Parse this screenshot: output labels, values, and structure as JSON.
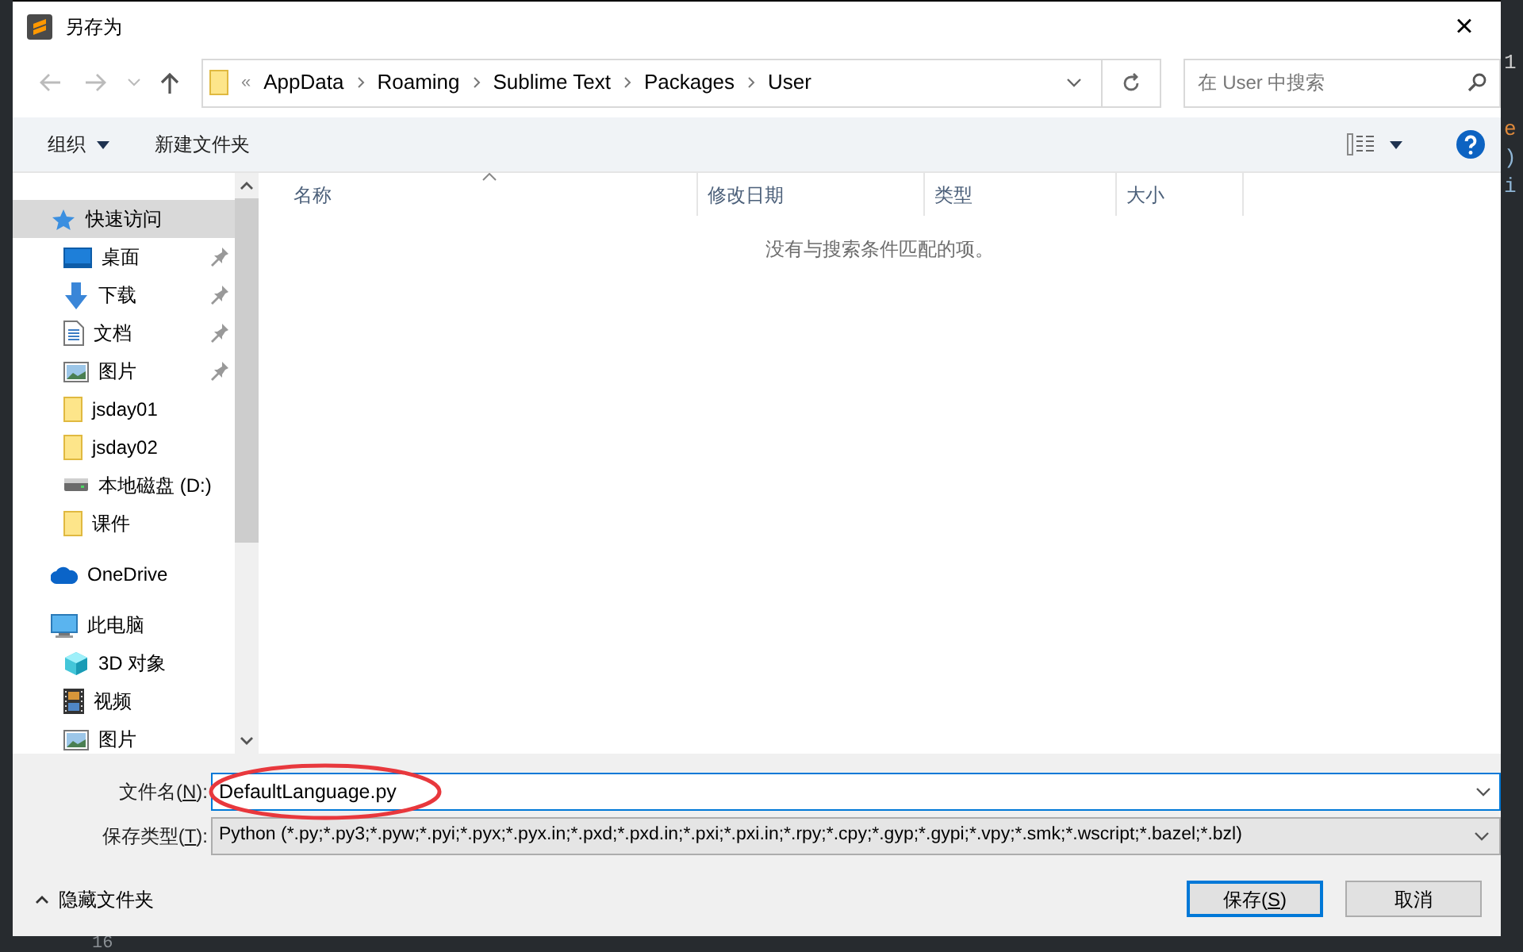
{
  "window": {
    "title": "另存为",
    "close": "×"
  },
  "address_bar": {
    "overflow": "«",
    "crumbs": [
      "AppData",
      "Roaming",
      "Sublime Text",
      "Packages",
      "User"
    ]
  },
  "search": {
    "placeholder": "在 User 中搜索"
  },
  "toolbar": {
    "organize": "组织",
    "new_folder": "新建文件夹"
  },
  "columns": [
    {
      "label": "名称",
      "sorted": true
    },
    {
      "label": "修改日期",
      "sorted": false
    },
    {
      "label": "类型",
      "sorted": false
    },
    {
      "label": "大小",
      "sorted": false
    }
  ],
  "empty_message": "没有与搜索条件匹配的项。",
  "sidebar": {
    "items": [
      {
        "label": "快速访问",
        "kind": "star",
        "selected": true,
        "children": [
          {
            "label": "桌面",
            "kind": "desktop",
            "pinned": true,
            "selected": false
          },
          {
            "label": "下载",
            "kind": "download",
            "pinned": true,
            "selected": false
          },
          {
            "label": "文档",
            "kind": "document",
            "pinned": true,
            "selected": false
          },
          {
            "label": "图片",
            "kind": "pictures",
            "pinned": true,
            "selected": false
          },
          {
            "label": "jsday01",
            "kind": "folder",
            "pinned": false,
            "selected": false
          },
          {
            "label": "jsday02",
            "kind": "folder",
            "pinned": false,
            "selected": false
          },
          {
            "label": "本地磁盘 (D:)",
            "kind": "drive",
            "pinned": false,
            "selected": false
          },
          {
            "label": "课件",
            "kind": "folder",
            "pinned": false,
            "selected": false
          }
        ]
      },
      {
        "label": "OneDrive",
        "kind": "cloud",
        "selected": false
      },
      {
        "label": "此电脑",
        "kind": "pc",
        "selected": false,
        "children": [
          {
            "label": "3D 对象",
            "kind": "cube",
            "pinned": false,
            "selected": false
          },
          {
            "label": "视频",
            "kind": "video",
            "pinned": false,
            "selected": false
          },
          {
            "label": "图片",
            "kind": "pictures",
            "pinned": false,
            "selected": false
          }
        ]
      }
    ]
  },
  "filename": {
    "label": {
      "before": "文件名(",
      "key": "N",
      "after": "):"
    },
    "value": "DefaultLanguage.py"
  },
  "filetype": {
    "label": {
      "before": "保存类型(",
      "key": "T",
      "after": "):"
    },
    "value": "Python (*.py;*.py3;*.pyw;*.pyi;*.pyx;*.pyx.in;*.pxd;*.pxd.in;*.pxi;*.pxi.in;*.rpy;*.cpy;*.gyp;*.gypi;*.vpy;*.smk;*.wscript;*.bazel;*.bzl)"
  },
  "hide_folders": "隐藏文件夹",
  "buttons": [
    {
      "label": {
        "before": "保存(",
        "key": "S",
        "after": ")"
      },
      "default": true
    },
    {
      "label": {
        "before": "取消"
      },
      "default": false
    }
  ],
  "annotation": {
    "kind": "ellipse",
    "color": "#e8383d"
  },
  "background_editor": {
    "chars": [
      "1",
      "e",
      ")",
      "i"
    ],
    "line_number": "16"
  }
}
